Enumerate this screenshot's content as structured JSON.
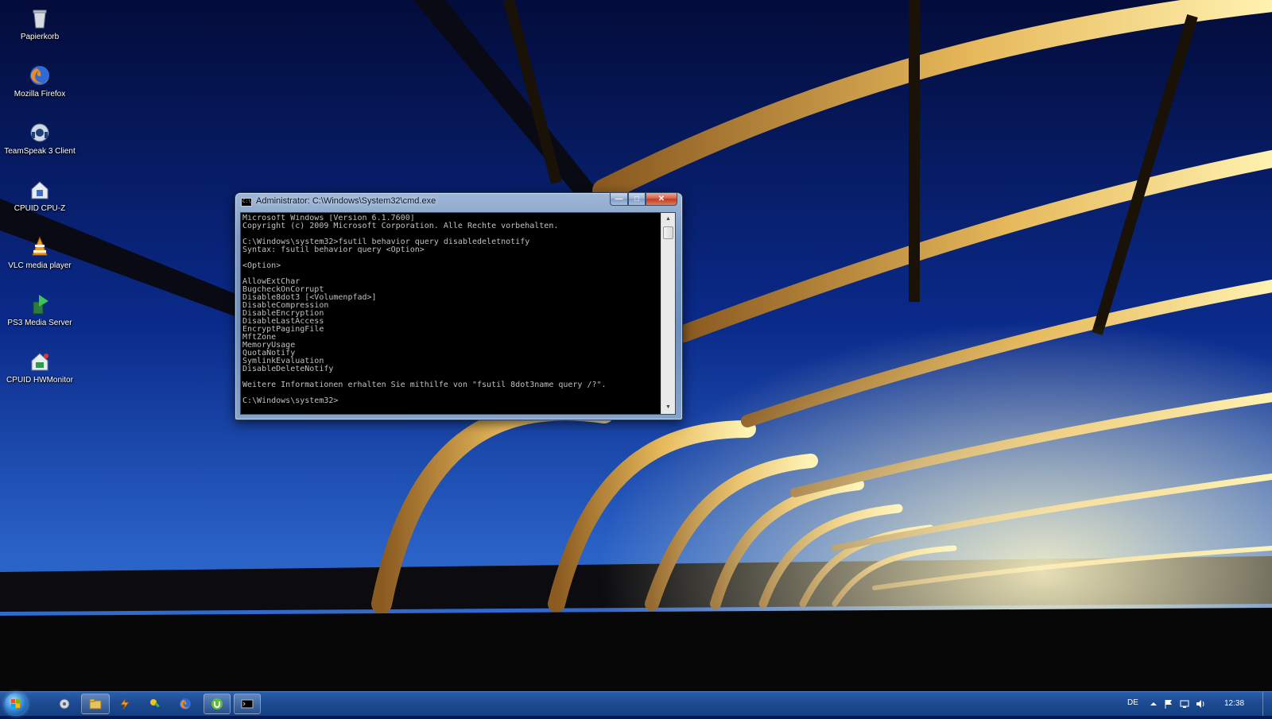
{
  "desktop": {
    "icons": [
      {
        "label": "Papierkorb",
        "icon": "recycle-bin-icon"
      },
      {
        "label": "Mozilla Firefox",
        "icon": "firefox-icon"
      },
      {
        "label": "TeamSpeak 3 Client",
        "icon": "teamspeak-icon"
      },
      {
        "label": "CPUID CPU-Z",
        "icon": "cpuz-icon"
      },
      {
        "label": "VLC media player",
        "icon": "vlc-icon"
      },
      {
        "label": "PS3 Media Server",
        "icon": "ps3-media-server-icon"
      },
      {
        "label": "CPUID HWMonitor",
        "icon": "hwmonitor-icon"
      }
    ]
  },
  "cmd_window": {
    "title": "Administrator: C:\\Windows\\System32\\cmd.exe",
    "title_icon_text": "C:\\",
    "minimize": "—",
    "maximize": "□",
    "close": "✕",
    "lines": [
      "Microsoft Windows [Version 6.1.7600]",
      "Copyright (c) 2009 Microsoft Corporation. Alle Rechte vorbehalten.",
      "",
      "C:\\Windows\\system32>fsutil behavior query disabledeletnotify",
      "Syntax: fsutil behavior query <Option>",
      "",
      "<Option>",
      "",
      "AllowExtChar",
      "BugcheckOnCorrupt",
      "Disable8dot3 [<Volumenpfad>]",
      "DisableCompression",
      "DisableEncryption",
      "DisableLastAccess",
      "EncryptPagingFile",
      "MftZone",
      "MemoryUsage",
      "QuotaNotify",
      "SymlinkEvaluation",
      "DisableDeleteNotify",
      "",
      "Weitere Informationen erhalten Sie mithilfe von \"fsutil 8dot3name query /?\".",
      "",
      "C:\\Windows\\system32>"
    ]
  },
  "taskbar": {
    "start": "start-orb",
    "buttons": [
      {
        "icon": "network-config-icon",
        "active": false
      },
      {
        "icon": "windows-explorer-icon",
        "active": true
      },
      {
        "icon": "winamp-icon",
        "active": false
      },
      {
        "icon": "tool-icon",
        "active": false
      },
      {
        "icon": "firefox-icon",
        "active": false
      },
      {
        "icon": "utorrent-icon",
        "active": true
      },
      {
        "icon": "cmd-icon",
        "active": true
      }
    ],
    "tray": {
      "language": "DE",
      "clock": "12:38",
      "icons": [
        "show-hidden-icons-icon",
        "action-center-flag-icon",
        "network-icon",
        "volume-icon"
      ]
    }
  },
  "colors": {
    "console_text": "#c0c0c0",
    "console_bg": "#000000",
    "taskbar": "#1d4c94",
    "sky_top": "#061650",
    "sky_bottom": "#2a63c8"
  }
}
